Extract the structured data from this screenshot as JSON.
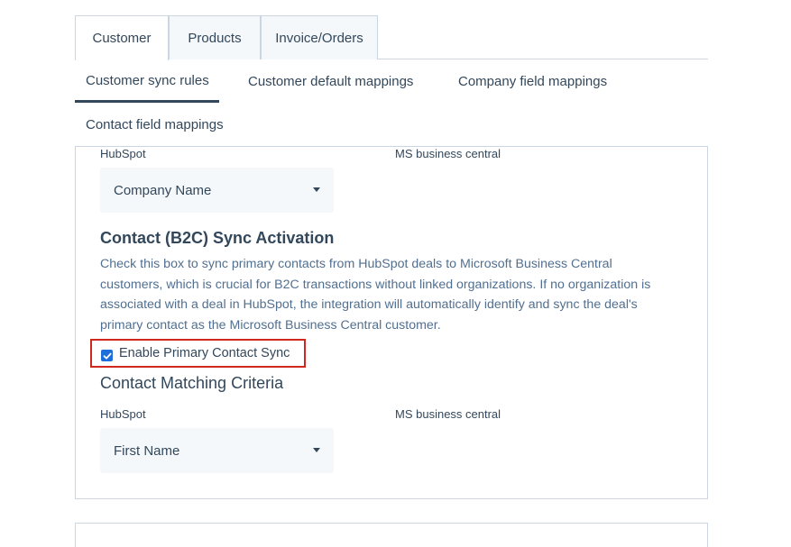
{
  "tabs": [
    {
      "label": "Customer"
    },
    {
      "label": "Products"
    },
    {
      "label": "Invoice/Orders"
    }
  ],
  "subtabs": [
    {
      "label": "Customer sync rules"
    },
    {
      "label": "Customer default mappings"
    },
    {
      "label": "Company field mappings"
    },
    {
      "label": "Contact field mappings"
    }
  ],
  "company_mapping": {
    "left_label": "HubSpot",
    "right_label": "MS business central",
    "selected": "Company Name"
  },
  "b2c": {
    "title": "Contact (B2C) Sync Activation",
    "description": "Check this box to sync primary contacts from HubSpot deals to Microsoft Business Central customers, which is crucial for B2C transactions without linked organizations. If no organization is associated with a deal in HubSpot, the integration will automatically identify and sync the deal's primary contact as the Microsoft Business Central customer.",
    "checkbox_label": "Enable Primary Contact Sync",
    "checked": true
  },
  "contact_matching": {
    "title": "Contact Matching Criteria",
    "left_label": "HubSpot",
    "right_label": "MS business central",
    "selected": "First Name"
  },
  "colors": {
    "text": "#33475b",
    "muted": "#516f90",
    "border": "#cbd6e2",
    "select_bg": "#f5f8fa",
    "checkbox": "#1f6fdb",
    "highlight": "#d0281f"
  }
}
